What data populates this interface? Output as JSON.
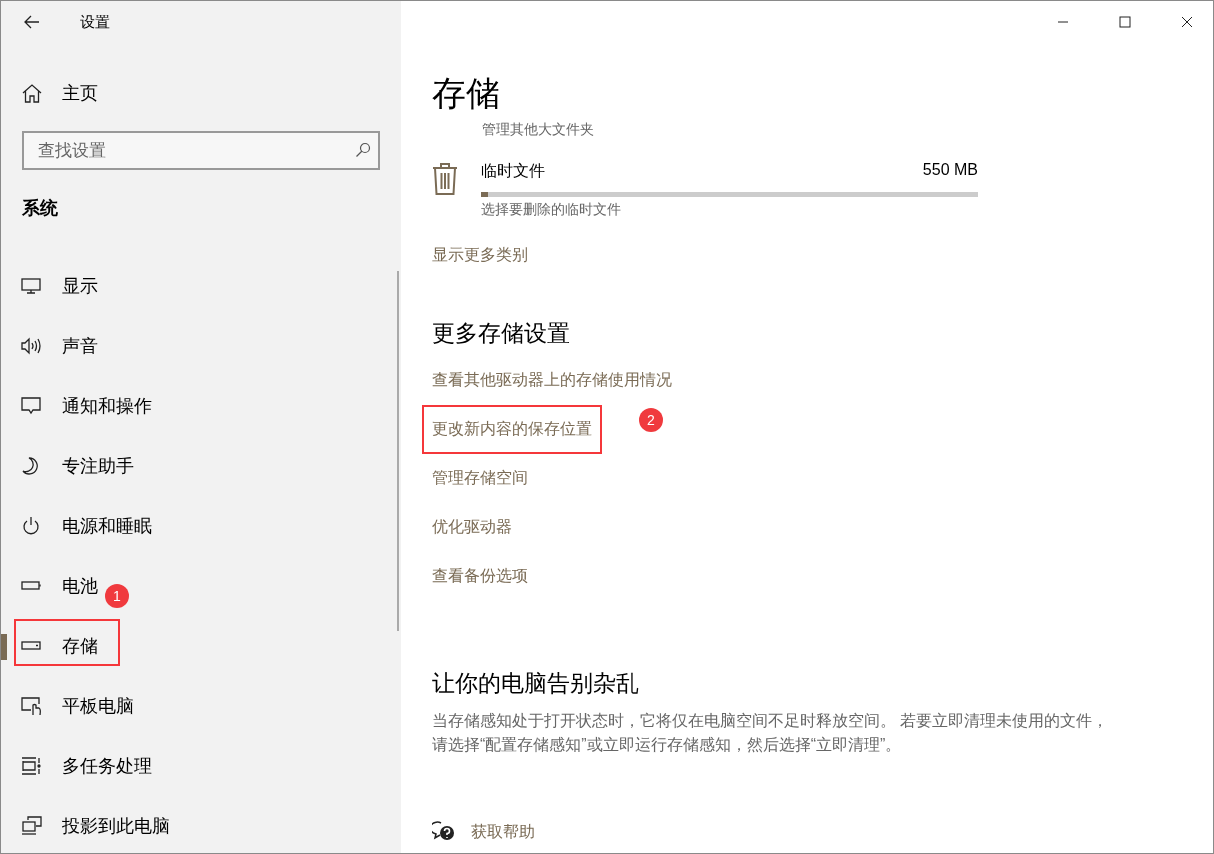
{
  "window": {
    "title": "设置"
  },
  "sidebar": {
    "home": "主页",
    "search": {
      "placeholder": "查找设置"
    },
    "section": "系统",
    "items": [
      {
        "label": "显示",
        "kind": "display",
        "selected": false
      },
      {
        "label": "声音",
        "kind": "sound",
        "selected": false
      },
      {
        "label": "通知和操作",
        "kind": "notification",
        "selected": false
      },
      {
        "label": "专注助手",
        "kind": "focus",
        "selected": false
      },
      {
        "label": "电源和睡眠",
        "kind": "power",
        "selected": false
      },
      {
        "label": "电池",
        "kind": "battery",
        "selected": false
      },
      {
        "label": "存储",
        "kind": "storage",
        "selected": true,
        "marked": true,
        "badge": "1"
      },
      {
        "label": "平板电脑",
        "kind": "tablet",
        "selected": false
      },
      {
        "label": "多任务处理",
        "kind": "multitask",
        "selected": false
      },
      {
        "label": "投影到此电脑",
        "kind": "project",
        "selected": false
      }
    ]
  },
  "page": {
    "title": "存储",
    "folder_link": "管理其他大文件夹",
    "category": {
      "name": "临时文件",
      "size": "550 MB",
      "level": 0.015,
      "description": "选择要删除的临时文件"
    },
    "more_link": "显示更多类别",
    "more_settings": {
      "heading": "更多存储设置",
      "links": [
        {
          "label": "查看其他驱动器上的存储使用情况",
          "marked": false
        },
        {
          "label": "更改新内容的保存位置",
          "marked": true,
          "badge": "2"
        },
        {
          "label": "管理存储空间",
          "marked": false
        },
        {
          "label": "优化驱动器",
          "marked": false
        },
        {
          "label": "查看备份选项",
          "marked": false
        }
      ]
    },
    "declutter": {
      "heading": "让你的电脑告别杂乱",
      "lines": [
        "当存储感知处于打开状态时，它将仅在电脑空间不足时释放空间。 若要立即清理未使用的文件，",
        "请选择“配置存储感知”或立即运行存储感知，然后选择“立即清理”。"
      ]
    },
    "help": "获取帮助"
  }
}
